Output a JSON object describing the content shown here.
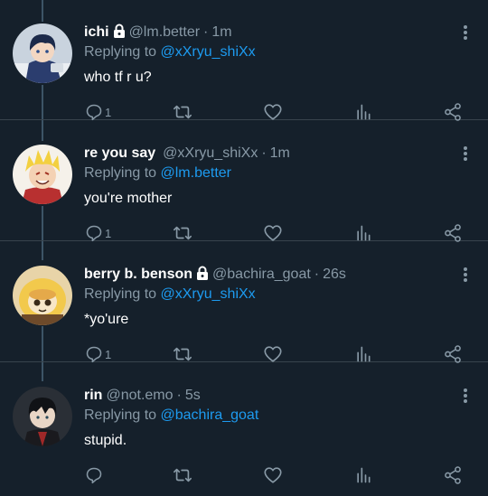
{
  "colors": {
    "background": "#15202b",
    "muted": "#8899a6",
    "link": "#1d9bf0",
    "divider": "#38444d",
    "thread": "#3d5466"
  },
  "tweets": [
    {
      "name": "ichi",
      "locked": true,
      "handle": "@lm.better",
      "time": "1m",
      "replying_prefix": "Replying to",
      "replying_to": "@xXryu_shiXx",
      "text": "who tf r u?",
      "reply_count": "1",
      "avatar_icon": "anime-boy-avatar"
    },
    {
      "name": "re you say",
      "locked": false,
      "handle": "@xXryu_shiXx",
      "time": "1m",
      "replying_prefix": "Replying to",
      "replying_to": "@lm.better",
      "text": "you're mother",
      "reply_count": "1",
      "avatar_icon": "blond-anime-avatar"
    },
    {
      "name": "berry b. benson",
      "locked": true,
      "handle": "@bachira_goat",
      "time": "26s",
      "replying_prefix": "Replying to",
      "replying_to": "@xXryu_shiXx",
      "text": "*yo'ure",
      "reply_count": "1",
      "avatar_icon": "yellow-hood-avatar"
    },
    {
      "name": "rin",
      "locked": false,
      "handle": "@not.emo",
      "time": "5s",
      "replying_prefix": "Replying to",
      "replying_to": "@bachira_goat",
      "text": "stupid.",
      "reply_count": "",
      "avatar_icon": "dark-hair-avatar"
    }
  ]
}
